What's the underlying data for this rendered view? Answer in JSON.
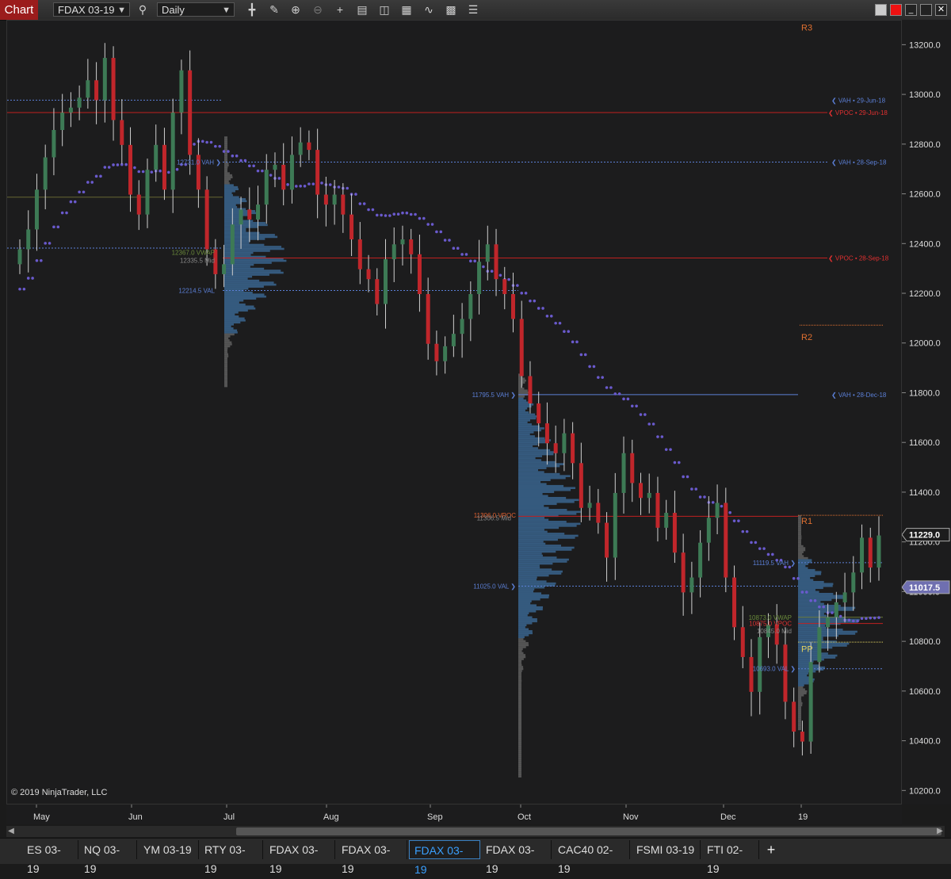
{
  "toolbar": {
    "chart_label": "Chart",
    "instrument": "FDAX 03-19",
    "interval": "Daily"
  },
  "copyright": "© 2019 NinjaTrader, LLC",
  "price_axis": {
    "ticks": [
      "13200.0",
      "13000.0",
      "12800.0",
      "12600.0",
      "12400.0",
      "12200.0",
      "12000.0",
      "11800.0",
      "11600.0",
      "11400.0",
      "11200.0",
      "11000.0",
      "10800.0",
      "10600.0",
      "10400.0",
      "10200.0"
    ],
    "last_price": "11229.0",
    "ma_price": "11017.5"
  },
  "date_axis": [
    "May",
    "Jun",
    "Jul",
    "Aug",
    "Sep",
    "Oct",
    "Nov",
    "Dec",
    "19"
  ],
  "levels": {
    "vah_jun": "❮ VAH • 29-Jun-18",
    "vpoc_jun": "❮ VPOC • 29-Jun-18",
    "vah_sep": "❮ VAH • 28-Sep-18",
    "vpoc_sep": "❮ VPOC • 28-Sep-18",
    "vah_dec": "❮ VAH • 28-Dec-18",
    "r3": "R3",
    "r2": "R2",
    "r1": "R1",
    "pp": "PP"
  },
  "profile_labels": {
    "p1_vah": "12731.0 VAH ❯",
    "p1_vwap": "12367.0 VWAP",
    "p1_mid": "12335.5 Mid",
    "p1_val": "12214.5 VAL",
    "p2_vah": "11795.5 VAH ❯",
    "p2_vpoc": "11306.0 VPOC",
    "p2_mid": "11306.5 Mid",
    "p2_val": "11025.0 VAL ❯",
    "p3_vah": "11119.5 VAH ❯",
    "p3_vwap": "10873.0 VWAP",
    "p3_vpoc": "10875.0 VPOC",
    "p3_mid": "10845.0 Mid",
    "p3_val": "10693.0 VAL ❯"
  },
  "tabs": [
    "ES 03-19",
    "NQ 03-19",
    "YM 03-19",
    "RTY 03-19",
    "FDAX 03-19",
    "FDAX 03-19",
    "FDAX 03-19",
    "FDAX 03-19",
    "CAC40 02-19",
    "FSMI 03-19",
    "FTI 02-19"
  ],
  "active_tab_index": 6,
  "colors": {
    "up": "#3d7a55",
    "down": "#c0262b",
    "vah": "#5b7fd6",
    "vpoc": "#c02020",
    "ma": "#6a5acd",
    "pivot": "#e07030"
  },
  "chart_data": {
    "type": "candlestick",
    "instrument": "FDAX 03-19",
    "interval": "Daily",
    "ylim": [
      10150,
      13300
    ],
    "x_labels": [
      "May",
      "Jun",
      "Jul",
      "Aug",
      "Sep",
      "Oct",
      "Nov",
      "Dec",
      "19"
    ],
    "closes": [
      12380,
      12460,
      12620,
      12750,
      12860,
      12930,
      12950,
      12990,
      13060,
      12980,
      13150,
      12900,
      12800,
      12600,
      12520,
      12700,
      12800,
      12620,
      12930,
      13100,
      12760,
      12620,
      12380,
      12280,
      12320,
      12480,
      12540,
      12500,
      12560,
      12700,
      12720,
      12620,
      12760,
      12810,
      12780,
      12600,
      12560,
      12600,
      12520,
      12420,
      12300,
      12260,
      12160,
      12340,
      12400,
      12420,
      12360,
      12200,
      12000,
      11930,
      11990,
      12040,
      12100,
      12200,
      12330,
      12400,
      12260,
      12200,
      12100,
      11870,
      11760,
      11680,
      11600,
      11560,
      11640,
      11520,
      11340,
      11360,
      11280,
      11140,
      11400,
      11560,
      11440,
      11380,
      11400,
      11260,
      11320,
      11160,
      11000,
      11060,
      11200,
      11300,
      11360,
      11060,
      10860,
      10740,
      10600,
      10820,
      10870,
      10790,
      10560,
      10440,
      10400,
      10720,
      10860,
      10900,
      10960,
      11000,
      11080,
      11220,
      11100,
      11229
    ],
    "moving_average_last": 11017.5
  }
}
